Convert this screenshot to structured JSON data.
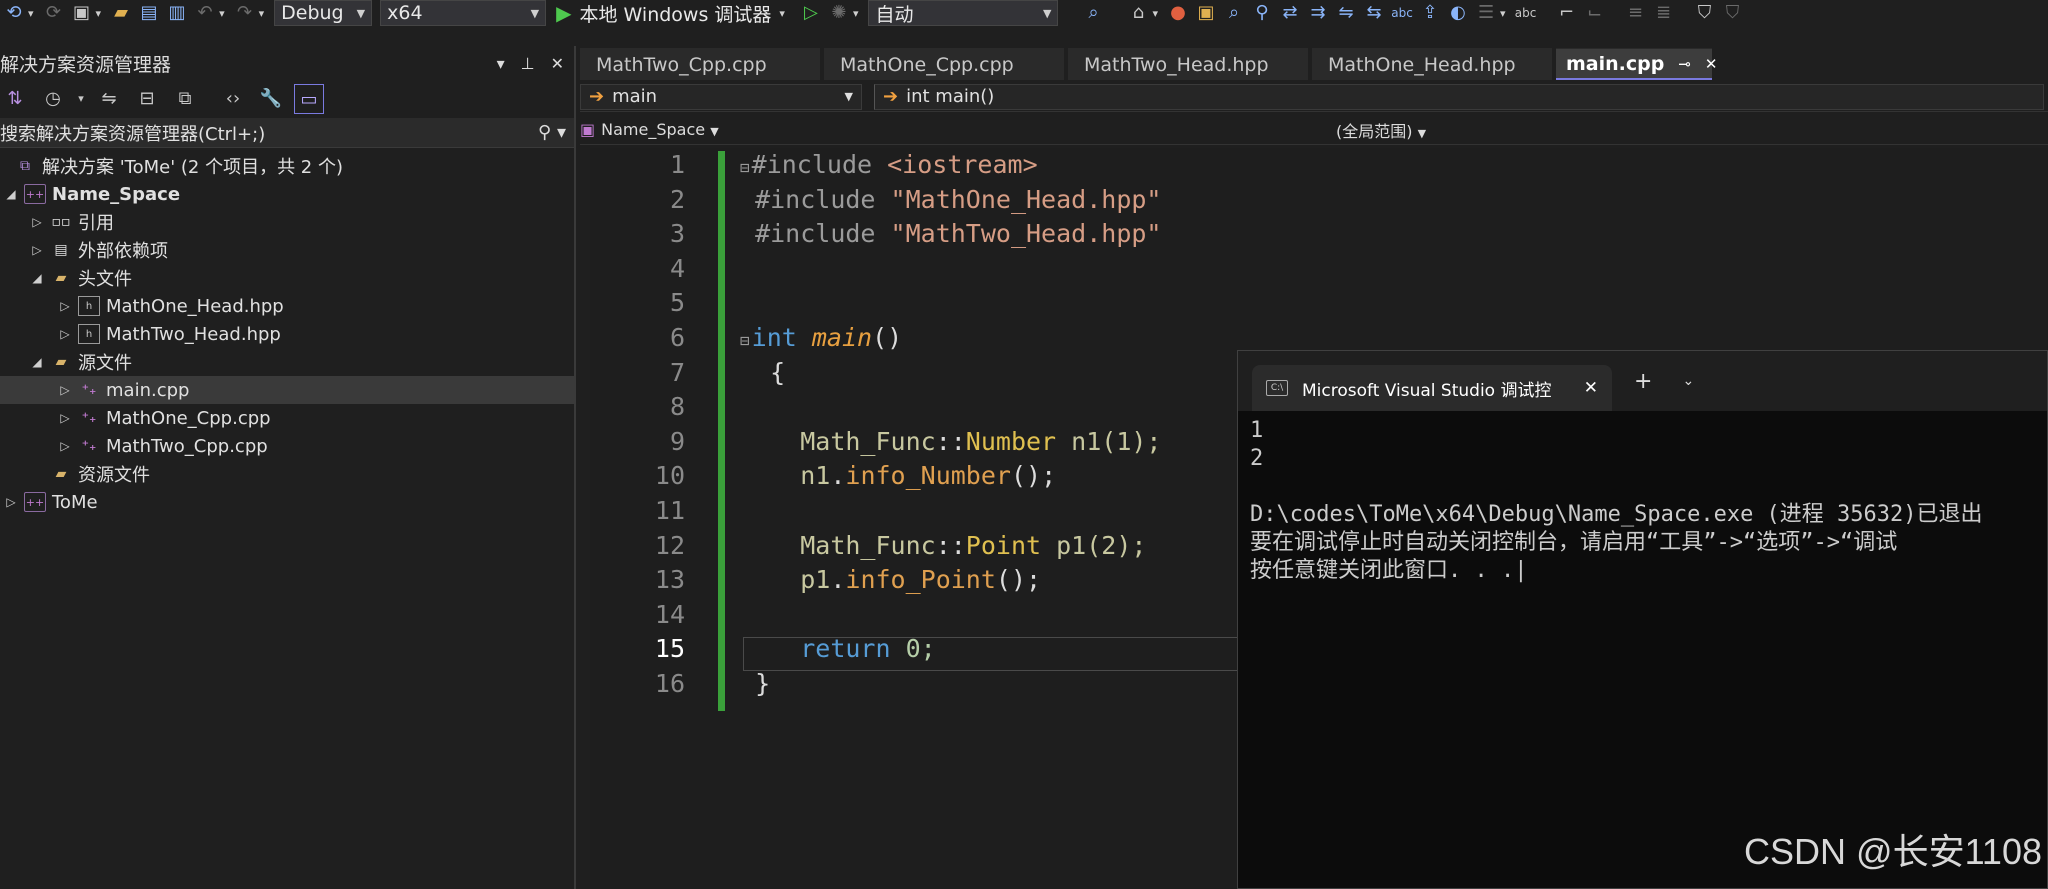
{
  "toolbar": {
    "config": "Debug",
    "platform": "x64",
    "run_label": "本地 Windows 调试器",
    "auto": "自动"
  },
  "solution_explorer": {
    "title": "解决方案资源管理器",
    "search_placeholder": "搜索解决方案资源管理器(Ctrl+;)",
    "items": [
      {
        "label": "解决方案 'ToMe' (2 个项目，共 2 个)"
      },
      {
        "label": "Name_Space"
      },
      {
        "label": "引用"
      },
      {
        "label": "外部依赖项"
      },
      {
        "label": "头文件"
      },
      {
        "label": "MathOne_Head.hpp"
      },
      {
        "label": "MathTwo_Head.hpp"
      },
      {
        "label": "源文件"
      },
      {
        "label": "main.cpp"
      },
      {
        "label": "MathOne_Cpp.cpp"
      },
      {
        "label": "MathTwo_Cpp.cpp"
      },
      {
        "label": "资源文件"
      },
      {
        "label": "ToMe"
      }
    ]
  },
  "editor": {
    "tabs": [
      {
        "label": "MathTwo_Cpp.cpp"
      },
      {
        "label": "MathOne_Cpp.cpp"
      },
      {
        "label": "MathTwo_Head.hpp"
      },
      {
        "label": "MathOne_Head.hpp"
      },
      {
        "label": "main.cpp"
      }
    ],
    "nav_scope": "main",
    "nav_member": "int main()",
    "nav_project": "Name_Space",
    "nav_global": "(全局范围)",
    "line_numbers": [
      "1",
      "2",
      "3",
      "4",
      "5",
      "6",
      "7",
      "8",
      "9",
      "10",
      "11",
      "12",
      "13",
      "14",
      "15",
      "16"
    ],
    "code": {
      "inc1_dir": "#include",
      "inc1_arg": "<iostream>",
      "inc2_dir": "#include",
      "inc2_arg": "\"MathOne_Head.hpp\"",
      "inc3_dir": "#include",
      "inc3_arg": "\"MathTwo_Head.hpp\"",
      "l6_kw": "int",
      "l6_fn": "main",
      "l6_paren": "()",
      "l7": "{",
      "l9_ns": "Math_Func",
      "l9_sep": "::",
      "l9_type": "Number",
      "l9_var": "n1",
      "l9_args": "(1);",
      "l10_var": "n1",
      "l10_dot": ".",
      "l10_fn": "info_Number",
      "l10_end": "();",
      "l12_ns": "Math_Func",
      "l12_sep": "::",
      "l12_type": "Point",
      "l12_var": "p1",
      "l12_args": "(2);",
      "l13_var": "p1",
      "l13_dot": ".",
      "l13_fn": "info_Point",
      "l13_end": "();",
      "l15_kw": "return",
      "l15_val": "0;",
      "l16": "}"
    }
  },
  "console": {
    "tab_title": "Microsoft Visual Studio 调试控",
    "output": "1\n2\n\nD:\\codes\\ToMe\\x64\\Debug\\Name_Space.exe (进程 35632)已退出\n要在调试停止时自动关闭控制台，请启用“工具”->“选项”->“调试\n按任意键关闭此窗口. . .|"
  },
  "watermark": "CSDN @长安1108"
}
